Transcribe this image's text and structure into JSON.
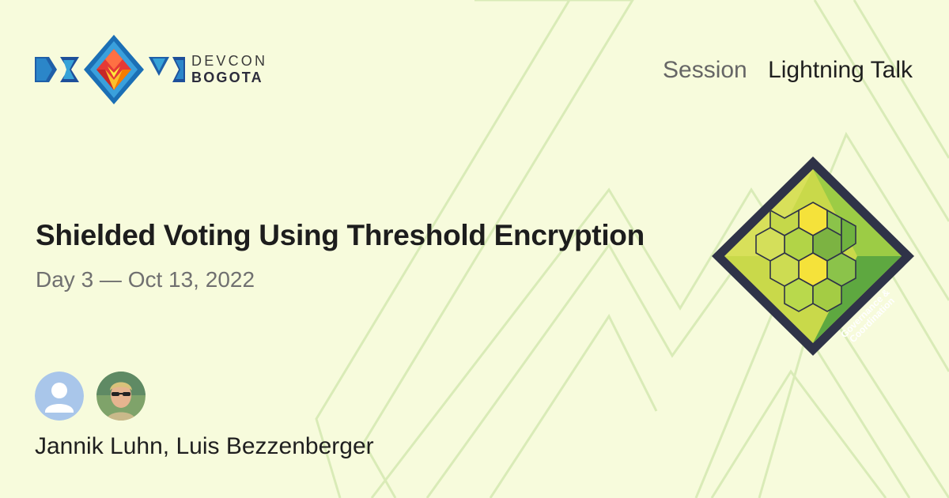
{
  "brand": {
    "line1": "DEVCON",
    "line2": "BOGOTA"
  },
  "session": {
    "type_label": "Session",
    "kind_label": "Lightning Talk"
  },
  "talk": {
    "title": "Shielded Voting Using Threshold Encryption",
    "date": "Day 3 — Oct 13, 2022"
  },
  "track": {
    "name": "Governance & Coordination",
    "icon": "governance-track-badge"
  },
  "speakers": {
    "names": "Jannik Luhn, Luis Bezzenberger",
    "avatars": [
      "default-user-avatar",
      "speaker-photo-avatar"
    ]
  },
  "colors": {
    "background": "#f7fbdc",
    "pattern_line": "#d9ebb7",
    "badge_border": "#2f3348",
    "badge_green": "#8bc34a",
    "badge_yellow": "#f5e23a"
  }
}
